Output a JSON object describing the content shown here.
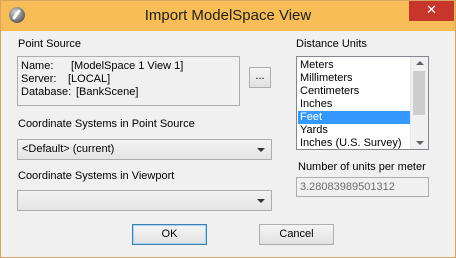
{
  "window": {
    "title": "Import ModelSpace View",
    "close_glyph": "✕",
    "colors": {
      "titlebar": "#f8bd56",
      "close": "#c7352b",
      "selection": "#3399ff"
    }
  },
  "point_source": {
    "heading": "Point Source",
    "name_label": "Name:",
    "name_value": "[ModelSpace 1 View 1]",
    "server_label": "Server:",
    "server_value": "[LOCAL]",
    "database_label": "Database:",
    "database_value": "[BankScene]",
    "browse_label": "..."
  },
  "coord_source": {
    "heading": "Coordinate Systems in Point Source",
    "selected": "<Default> (current)"
  },
  "coord_viewport": {
    "heading": "Coordinate Systems in Viewport",
    "selected": ""
  },
  "distance_units": {
    "heading": "Distance Units",
    "items": [
      "Meters",
      "Millimeters",
      "Centimeters",
      "Inches",
      "Feet",
      "Yards",
      "Inches (U.S. Survey)"
    ],
    "selected": "Feet",
    "units_per_meter_label": "Number of units per meter",
    "units_per_meter_value": "3.28083989501312"
  },
  "buttons": {
    "ok": "OK",
    "cancel": "Cancel"
  }
}
